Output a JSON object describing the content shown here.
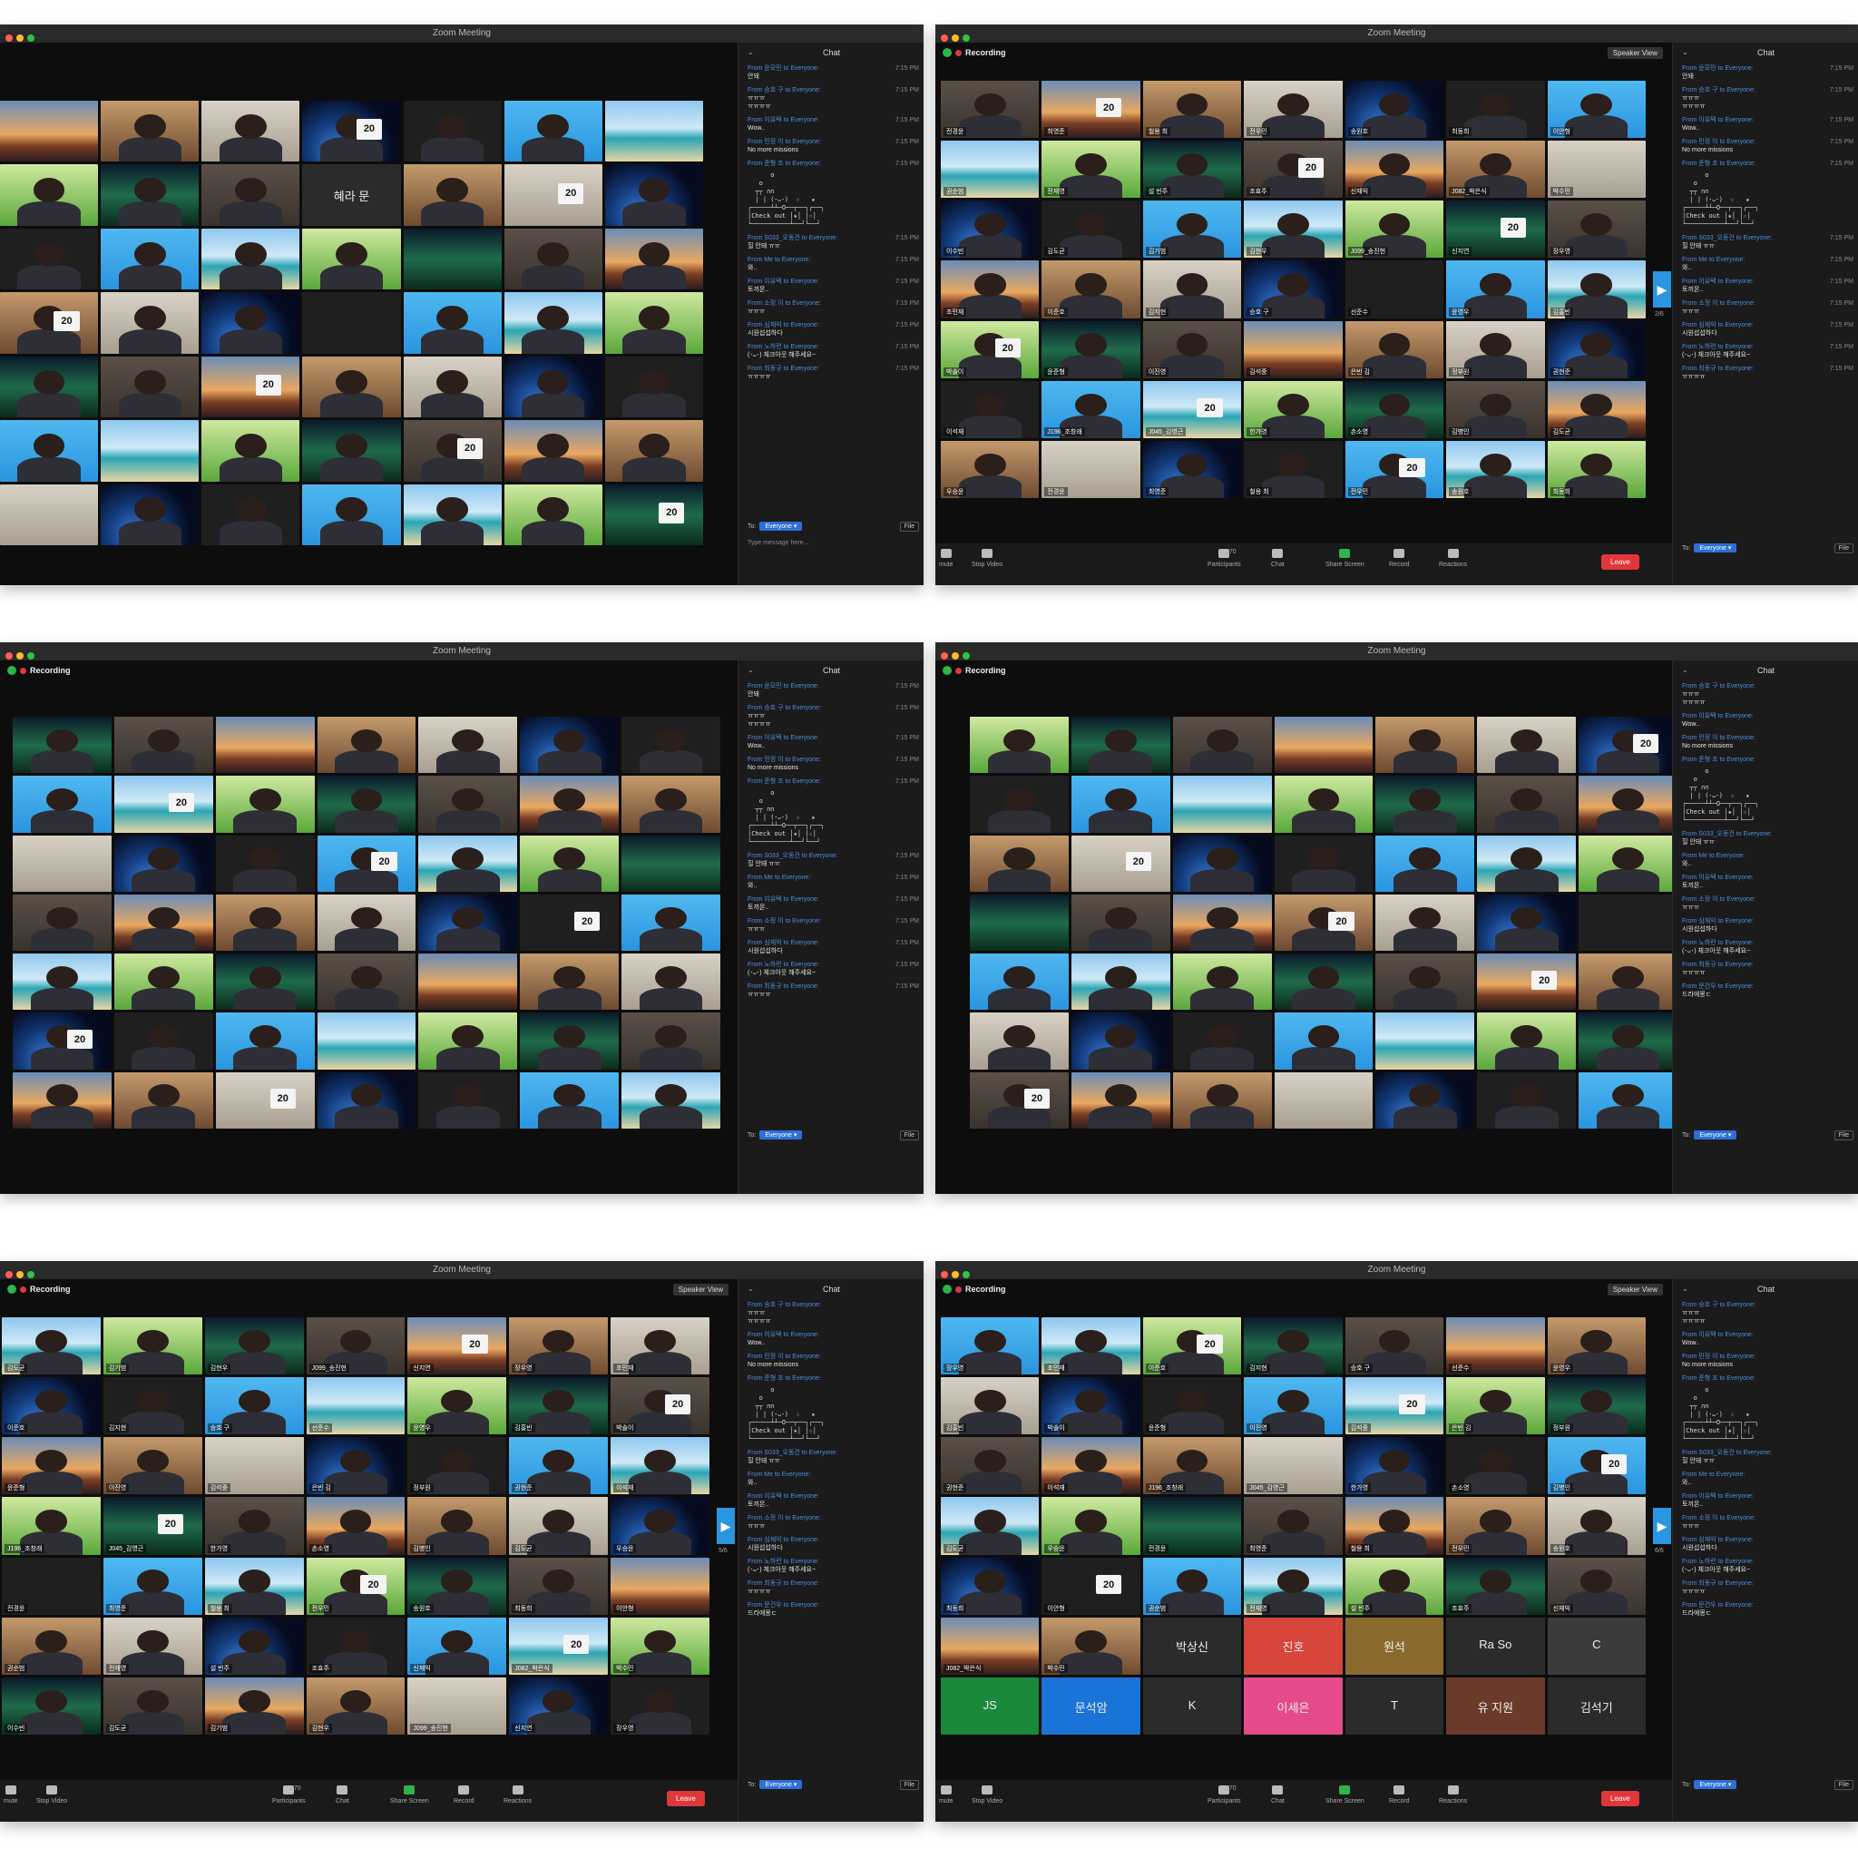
{
  "app_title": "Zoom Meeting",
  "recording_label": "Recording",
  "speaker_view_label": "Speaker View",
  "chat_title": "Chat",
  "to_label": "To:",
  "everyone_label": "Everyone ▾",
  "file_label": "File",
  "type_placeholder": "Type message here...",
  "leave_label": "Leave",
  "participants_count": "270",
  "toolbar": {
    "mute": "mute",
    "stop_video": "Stop Video",
    "participants": "Participants",
    "chat": "Chat",
    "share_screen": "Share Screen",
    "record": "Record",
    "reactions": "Reactions"
  },
  "colors": {
    "accent_blue": "#2d6fd6",
    "leave_red": "#e0373b",
    "share_green": "#2fb34a",
    "recording_dot": "#e0373b"
  },
  "ascii_art": "      o\n   o\n  ┬┬ ∩∩\n  | | (･ᴗ･)  ☆   ★\n┌─────┴┴─O──┬──┐┌──┐\n│Check out │★│ │☆│\n└──────────┴──┘└──┘",
  "chat_sets": {
    "A": [
      {
        "from": "From 윤모민 to Everyone:",
        "text": "안돼",
        "time": "7:15 PM"
      },
      {
        "from": "From 승호 구 to Everyone:",
        "text": "ㅠㅠㅠ\nㅠㅠㅠㅠ",
        "time": "7:15 PM"
      },
      {
        "from": "From 이유택 to Everyone:",
        "text": "Wow..",
        "time": "7:15 PM"
      },
      {
        "from": "From 민정 이 to Everyone:",
        "text": "No more missions",
        "time": "7:15 PM"
      },
      {
        "from": "From 준형 조 to Everyone:",
        "text": "",
        "time": "7:15 PM",
        "ascii": true
      },
      {
        "from": "From S033_오동건 to Everyone:",
        "text": "힐 안돼 ㅠㅠ",
        "time": "7:15 PM"
      },
      {
        "from": "From Me to Everyone:",
        "text": "와..",
        "time": "7:15 PM"
      },
      {
        "from": "From 이유택 to Everyone:",
        "text": "토끼몬..",
        "time": "7:15 PM"
      },
      {
        "from": "From 소정 이 to Everyone:",
        "text": "ㅠㅠㅠ",
        "time": "7:15 PM"
      },
      {
        "from": "From 심재익 to Everyone:",
        "text": "시원섭섭하다",
        "time": "7:15 PM"
      },
      {
        "from": "From 노하련 to Everyone:",
        "text": "(･ᴗ･) 체크아웃 해주세요~",
        "time": "7:15 PM"
      },
      {
        "from": "From 최동규 to Everyone:",
        "text": "ㅠㅠㅠㅠ",
        "time": "7:15 PM"
      }
    ],
    "B": [
      {
        "from": "From 승호 구 to Everyone:",
        "text": "ㅠㅠㅠ\nㅠㅠㅠㅠ",
        "time": ""
      },
      {
        "from": "From 이유택 to Everyone:",
        "text": "Wow..",
        "time": ""
      },
      {
        "from": "From 민정 이 to Everyone:",
        "text": "No more missions",
        "time": ""
      },
      {
        "from": "From 준형 조 to Everyone:",
        "text": "",
        "time": "",
        "ascii": true
      },
      {
        "from": "From S033_오동건 to Everyone:",
        "text": "힐 안돼 ㅠㅠ",
        "time": ""
      },
      {
        "from": "From Me to Everyone:",
        "text": "와..",
        "time": ""
      },
      {
        "from": "From 이유택 to Everyone:",
        "text": "토끼몬..",
        "time": ""
      },
      {
        "from": "From 소정 이 to Everyone:",
        "text": "ㅠㅠㅠ",
        "time": ""
      },
      {
        "from": "From 심재익 to Everyone:",
        "text": "시원섭섭하다",
        "time": ""
      },
      {
        "from": "From 노하련 to Everyone:",
        "text": "(･ᴗ･) 체크아웃 해주세요~",
        "time": ""
      },
      {
        "from": "From 최동규 to Everyone:",
        "text": "ㅠㅠㅠㅠ",
        "time": ""
      },
      {
        "from": "From 문건우 to Everyone:",
        "text": "드라에몽ㄷ",
        "time": ""
      }
    ]
  },
  "windows": [
    {
      "page": "",
      "show_record": false,
      "show_speaker": false,
      "chat": "A",
      "name_tile": "혜라 문"
    },
    {
      "page": "2/6",
      "show_record": true,
      "show_speaker": true,
      "chat": "A"
    },
    {
      "page": "",
      "show_record": true,
      "show_speaker": false,
      "chat": "A"
    },
    {
      "page": "",
      "show_record": true,
      "show_speaker": false,
      "chat": "B"
    },
    {
      "page": "5/6",
      "show_record": true,
      "show_speaker": true,
      "chat": "B"
    },
    {
      "page": "6/6",
      "show_record": true,
      "show_speaker": true,
      "chat": "B",
      "text_tiles": [
        "박상신",
        "진호",
        "원석",
        "Ra So",
        "C",
        "JS",
        "문석암",
        "K",
        "이세은",
        "T",
        "유 지원",
        "김석기"
      ]
    }
  ],
  "tile_names": [
    "한가영",
    "손소영",
    "김병인",
    "김도균",
    "우승윤",
    "전경윤",
    "최영준",
    "철용 최",
    "전우민",
    "송원호",
    "최동희",
    "이안형",
    "권순범",
    "전재영",
    "설 빈주",
    "조효주",
    "신재익",
    "J082_박은식",
    "박수민",
    "이수빈",
    "김도균",
    "김기범",
    "김현우",
    "J099_송진현",
    "신지연",
    "장우영",
    "조민재",
    "이준호",
    "김지현",
    "승호 구",
    "선준수",
    "윤영우",
    "김홍빈",
    "박솔이",
    "윤준형",
    "이진영",
    "김석중",
    "은빈 김",
    "정부원",
    "권현준",
    "이석재",
    "J196_조창래",
    "J045_김영근"
  ]
}
